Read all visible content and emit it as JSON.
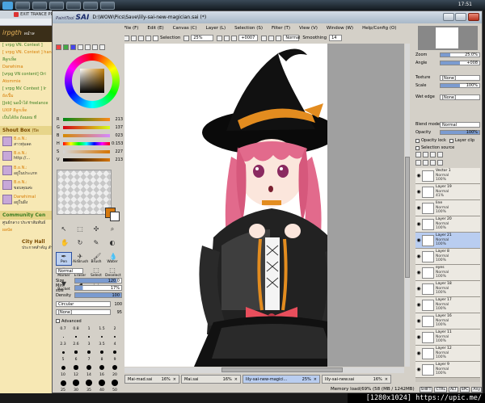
{
  "os": {
    "clock": "17:51"
  },
  "browser": {
    "tab_title": "EXIT TRANCE PR",
    "header": "irpgth",
    "header_suffix": "หน้าห",
    "lines": [
      "[ vrpg VN. Contest ]",
      "[ vrpg VN. Contest ] hangama",
      "สีลูกเห็ด ",
      "Darwhima",
      "[vrpg VN content] Ori",
      "Atommie",
      "[ vrpg NV. Contest ] Ir",
      "ยังเปิ้ม",
      "[Job] นอน้ำได้ freelance",
      "UXIP สีลูกเห็ด",
      "เป็นได้ถ้อ ถ้อมผม ที่"
    ],
    "shout_box_title": "Shout Box",
    "shout_box_close": "(ปิด",
    "shouts": [
      {
        "name": "B.o.N.:",
        "text": "สาวทุ่มลด"
      },
      {
        "name": "B.o.N.:",
        "text": "http://..."
      },
      {
        "name": "B.o.N.:",
        "text": "อยู่ในประเภท"
      },
      {
        "name": "B.o.N.:",
        "text": "ขอบคุณค่ะ"
      },
      {
        "name": "DarwhimaI",
        "text": "อยู่ในฝั่ง"
      }
    ],
    "community_title": "Community Cen",
    "community_sub": "ศูนย์กลาง ประชาสัมพันธ์",
    "community_sub2": "ผลบัด",
    "city_hall": "City Hall",
    "city_hall_sub": "ประกาศสำคัญ สำ"
  },
  "sai": {
    "brand_small": "PaintTool",
    "brand": "SAI",
    "file_path": "D:\\WOW\\Pics\\Save\\lily-sai-new-magician.sai (*)",
    "menu": [
      {
        "label": "File (F)"
      },
      {
        "label": "Edit (E)"
      },
      {
        "label": "Canvas (C)"
      },
      {
        "label": "Layer (L)"
      },
      {
        "label": "Selection (S)"
      },
      {
        "label": "Filter (T)"
      },
      {
        "label": "View (V)"
      },
      {
        "label": "Window (W)"
      },
      {
        "label": "Help/Config (O)"
      }
    ],
    "toolbar": {
      "selection_label": "Selection",
      "zoom": "25%",
      "rotation": "+0007",
      "blend": "Normal",
      "smoothing_label": "Smoothing",
      "smoothing_value": "14"
    },
    "color_sliders": [
      {
        "label": "R",
        "value": "213",
        "color": "#d5790f"
      },
      {
        "label": "G",
        "value": "137",
        "color": "#d5790f"
      },
      {
        "label": "B",
        "value": "023",
        "color": "#d5790f"
      },
      {
        "label": "H",
        "value": "0:153",
        "color": "#ff0000"
      },
      {
        "label": "S",
        "value": "227",
        "color": "#d5790f"
      },
      {
        "label": "V",
        "value": "213",
        "color": "#000000"
      }
    ],
    "tools": [
      [
        {
          "label": "",
          "icon": "↖"
        },
        {
          "label": "",
          "icon": "⬚"
        },
        {
          "label": "",
          "icon": "✣"
        },
        {
          "label": "",
          "icon": "⌕"
        }
      ],
      [
        {
          "label": "",
          "icon": "✋"
        },
        {
          "label": "",
          "icon": "↻"
        },
        {
          "label": "",
          "icon": "✎"
        },
        {
          "label": "",
          "icon": "◐"
        }
      ],
      [
        {
          "label": "Pen",
          "icon": "✒",
          "selected": true
        },
        {
          "label": "AirBrush",
          "icon": "✈"
        },
        {
          "label": "Brush",
          "icon": "🖌"
        },
        {
          "label": "Water",
          "icon": "💧"
        }
      ],
      [
        {
          "label": "Marker",
          "icon": "▮"
        },
        {
          "label": "Eraser",
          "icon": "▭"
        },
        {
          "label": "Select",
          "icon": "⬚"
        },
        {
          "label": "Deselect",
          "icon": "⬚"
        }
      ],
      [
        {
          "label": "Bucket",
          "icon": "▼"
        },
        {
          "label": "Binary",
          "icon": "◢"
        },
        {
          "label": "Blur",
          "icon": "◌"
        },
        {
          "label": "",
          "icon": ""
        }
      ]
    ],
    "brush": {
      "mode": "Normal",
      "size_label": "Size",
      "size_mult": "x 1.0",
      "size_value": "120.0",
      "size_fill": 0.9,
      "minsize_label": "Min size",
      "minsize_value": "17%",
      "minsize_fill": 0.17,
      "density_label": "Density",
      "density_value": "100",
      "density_fill": 1.0,
      "shape": "Circular",
      "shape_value": "100",
      "texture": "[None]",
      "texture_value": "95",
      "advanced_label": "Advanced",
      "sizes_row1": [
        "0.7",
        "0.8",
        "1",
        "1.5",
        "2"
      ],
      "sizes_row2": [
        "2.3",
        "2.6",
        "3",
        "3.5",
        "4"
      ],
      "sizes_row3": [
        "5",
        "6",
        "7",
        "8",
        "9"
      ],
      "sizes_row4": [
        "10",
        "12",
        "14",
        "16",
        "20"
      ],
      "sizes_row5": [
        "25",
        "30",
        "35",
        "40",
        "50"
      ]
    },
    "doc_tabs": [
      {
        "name": "Mai-mad.sai",
        "zoom": "16%",
        "active": false
      },
      {
        "name": "Mai.sai",
        "zoom": "16%",
        "active": false
      },
      {
        "name": "lily-sai-new-magici...",
        "zoom": "25%",
        "active": true
      },
      {
        "name": "lily-sai-new.sai",
        "zoom": "16%",
        "active": false
      }
    ],
    "status": {
      "memory": "Memory load(69% (58 (MB / 1242MB)",
      "keys": [
        "SHIFT",
        "CTRL",
        "ALT",
        "SPC",
        "Any"
      ]
    },
    "navigator": {
      "zoom_label": "Zoom",
      "zoom_value": "25.0%",
      "angle_label": "Angle",
      "angle_value": "+008"
    },
    "layer_props": {
      "texture_label": "Texture",
      "texture_value": "[None]",
      "scale_label": "Scale",
      "scale_value": "100%",
      "wetedge_label": "Wet edge",
      "wetedge_value": "[None]",
      "blend_label": "Blend mode",
      "blend_value": "Normal",
      "opacity_label": "Opacity",
      "opacity_value": "100%",
      "opacity_fill": 1.0,
      "opacity_lock": "Opacity lock",
      "layer_clip": "Layer clip",
      "selection_source": "Selection source"
    },
    "layers": [
      {
        "name": "Vector 1",
        "mode": "Normal",
        "opacity": "100%",
        "selected": false
      },
      {
        "name": "Layer 19",
        "mode": "Normal",
        "opacity": "41%",
        "selected": false
      },
      {
        "name": "line",
        "mode": "Normal",
        "opacity": "100%",
        "selected": false
      },
      {
        "name": "Layer 20",
        "mode": "Normal",
        "opacity": "100%",
        "selected": false
      },
      {
        "name": "Layer 21",
        "mode": "Normal",
        "opacity": "100%",
        "selected": true
      },
      {
        "name": "Layer 8",
        "mode": "Normal",
        "opacity": "100%",
        "selected": false
      },
      {
        "name": "eyes",
        "mode": "Normal",
        "opacity": "100%",
        "selected": false
      },
      {
        "name": "Layer 18",
        "mode": "Normal",
        "opacity": "100%",
        "selected": false
      },
      {
        "name": "Layer 17",
        "mode": "Normal",
        "opacity": "100%",
        "selected": false
      },
      {
        "name": "Layer 16",
        "mode": "Normal",
        "opacity": "100%",
        "selected": false
      },
      {
        "name": "Layer 11",
        "mode": "Normal",
        "opacity": "100%",
        "selected": false
      },
      {
        "name": "Layer 12",
        "mode": "Normal",
        "opacity": "100%",
        "selected": false
      },
      {
        "name": "Layer 9",
        "mode": "Normal",
        "opacity": "100%",
        "selected": false
      }
    ]
  },
  "watermark": "[1280x1024] https://upic.me/"
}
